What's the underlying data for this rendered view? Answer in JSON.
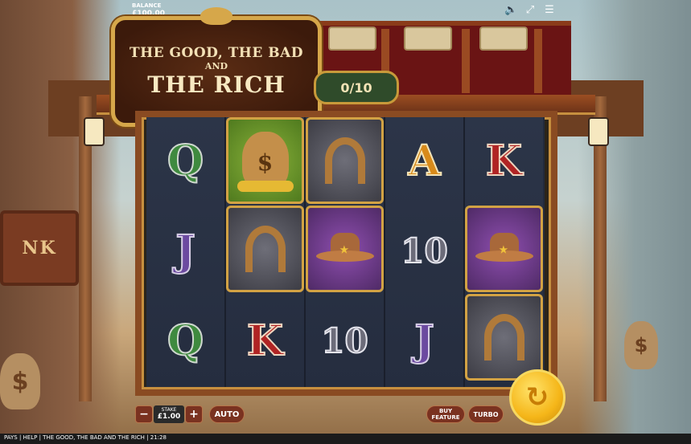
{
  "header": {
    "balance_label": "BALANCE",
    "balance_value": "£100.00",
    "icons": [
      "speaker-icon",
      "fullscreen-icon",
      "menu-icon"
    ]
  },
  "logo": {
    "line1": "THE GOOD, THE BAD",
    "line2": "AND",
    "line3": "THE RICH"
  },
  "counter": "0/10",
  "background": {
    "sign_text": "NK",
    "sack_symbol": "$"
  },
  "reels": [
    [
      "Q",
      "J",
      "Q"
    ],
    [
      "money-bag",
      "horseshoe",
      "K"
    ],
    [
      "horseshoe",
      "cowboy-hat",
      "10"
    ],
    [
      "A",
      "10",
      "J"
    ],
    [
      "K",
      "cowboy-hat",
      "horseshoe"
    ]
  ],
  "controls": {
    "minus": "−",
    "stake_label": "STAKE",
    "stake_value": "£1.00",
    "plus": "+",
    "auto": "AUTO",
    "buy_feature": "BUY FEATURE",
    "turbo": "TURBO"
  },
  "footer": {
    "text": "PAYS | HELP | THE GOOD, THE BAD AND THE RICH | 21:28"
  }
}
